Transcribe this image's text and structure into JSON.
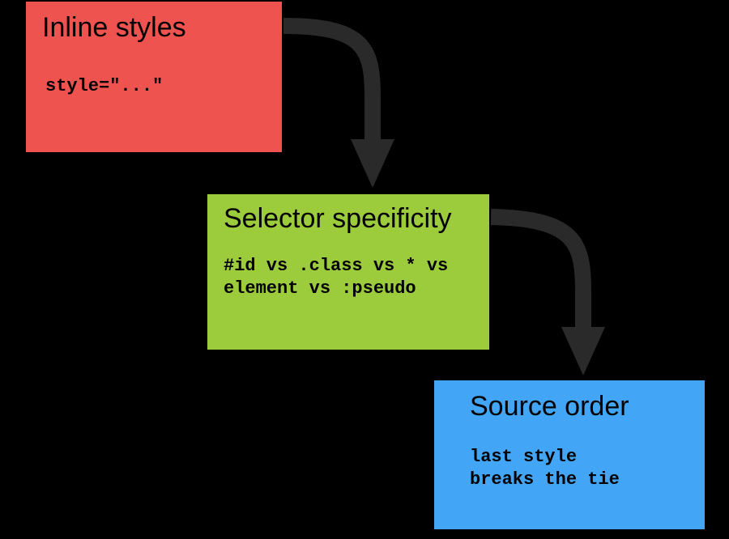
{
  "colors": {
    "box1": "#ef5350",
    "box2": "#9ccc3c",
    "box3": "#42a5f5",
    "arrow": "#2a2a2a"
  },
  "boxes": {
    "inline": {
      "title": "Inline styles",
      "code": "style=\"...\""
    },
    "specificity": {
      "title": "Selector specificity",
      "code": "#id vs .class vs * vs\nelement vs :pseudo"
    },
    "source": {
      "title": "Source order",
      "code": "last style\nbreaks the tie"
    }
  },
  "arrows": {
    "a1": {
      "from": "inline",
      "to": "specificity"
    },
    "a2": {
      "from": "specificity",
      "to": "source"
    }
  }
}
